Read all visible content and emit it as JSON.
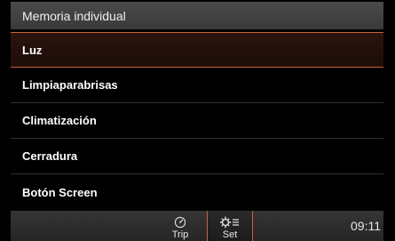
{
  "header": {
    "title": "Memoria individual"
  },
  "menu": {
    "items": [
      {
        "label": "Luz",
        "selected": true
      },
      {
        "label": "Limpiaparabrisas",
        "selected": false
      },
      {
        "label": "Climatización",
        "selected": false
      },
      {
        "label": "Cerradura",
        "selected": false
      },
      {
        "label": "Botón Screen",
        "selected": false
      }
    ]
  },
  "bottom_bar": {
    "trip_label": "Trip",
    "trip_icon": "gauge-icon",
    "set_label": "Set",
    "set_icon": "settings-list-icon",
    "active_tab": "Set",
    "clock": "09:11"
  },
  "colors": {
    "accent": "#c8623a",
    "background": "#000000",
    "header": "#404040"
  }
}
